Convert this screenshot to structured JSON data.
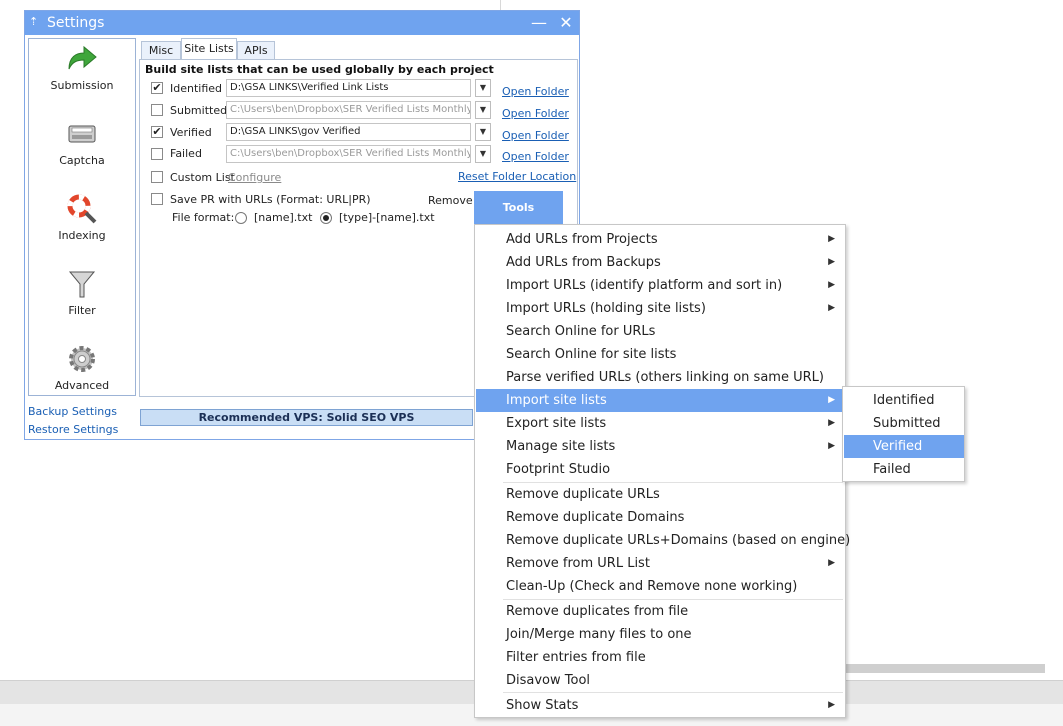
{
  "window": {
    "title": "Settings",
    "minimize_glyph": "—",
    "close_glyph": "✕"
  },
  "nav": {
    "items": [
      {
        "label": "Submission",
        "icon": "arrow-right-icon"
      },
      {
        "label": "Captcha",
        "icon": "captcha-keyboard-icon"
      },
      {
        "label": "Indexing",
        "icon": "lifebuoy-magnifier-icon"
      },
      {
        "label": "Filter",
        "icon": "funnel-icon"
      },
      {
        "label": "Advanced",
        "icon": "gear-icon"
      }
    ],
    "backup_label": "Backup Settings",
    "restore_label": "Restore Settings"
  },
  "tabs": [
    {
      "label": "Misc"
    },
    {
      "label": "Site Lists",
      "active": true
    },
    {
      "label": "APIs"
    }
  ],
  "site_lists": {
    "heading": "Build site lists that can be used globally by each project",
    "rows": [
      {
        "label": "Identified",
        "checked": true,
        "path": "D:\\GSA LINKS\\Verified Link Lists",
        "enabled": true,
        "link": "Open Folder"
      },
      {
        "label": "Submitted",
        "checked": false,
        "path": "C:\\Users\\ben\\Dropbox\\SER Verified Lists Monthly F",
        "enabled": false,
        "link": "Open Folder"
      },
      {
        "label": "Verified",
        "checked": true,
        "path": "D:\\GSA LINKS\\gov Verified",
        "enabled": true,
        "link": "Open Folder"
      },
      {
        "label": "Failed",
        "checked": false,
        "path": "C:\\Users\\ben\\Dropbox\\SER Verified Lists Monthly F",
        "enabled": false,
        "link": "Open Folder"
      }
    ],
    "custom_list_label": "Custom List",
    "configure_label": "Configure",
    "reset_folder_label": "Reset Folder Location",
    "save_pr_label": "Save PR with URLs (Format: URL|PR)",
    "remove_label": "Remove",
    "file_format_label": "File format:",
    "format_options": [
      "[name].txt",
      "[type]-[name].txt"
    ],
    "selected_format": "[type]-[name].txt",
    "tools_label": "Tools"
  },
  "vps_banner": "Recommended VPS: Solid SEO VPS",
  "checkmark_glyph": "✔",
  "dropdown_glyph": "▼",
  "submenu_arrow_glyph": "▶",
  "tools_menu": {
    "items": [
      {
        "label": "Add URLs from Projects",
        "submenu": true
      },
      {
        "label": "Add URLs from Backups",
        "submenu": true
      },
      {
        "label": "Import URLs (identify platform and sort in)",
        "submenu": true
      },
      {
        "label": "Import URLs (holding site lists)",
        "submenu": true
      },
      {
        "label": "Search Online for URLs",
        "submenu": false
      },
      {
        "label": "Search Online for site lists",
        "submenu": false
      },
      {
        "label": "Parse verified URLs (others linking on same URL)",
        "submenu": false
      },
      {
        "label": "Import site lists",
        "submenu": true,
        "highlighted": true
      },
      {
        "label": "Export site lists",
        "submenu": true
      },
      {
        "label": "Manage site lists",
        "submenu": true
      },
      {
        "label": "Footprint Studio",
        "submenu": false
      },
      {
        "label": "Remove duplicate URLs",
        "submenu": false
      },
      {
        "label": "Remove duplicate Domains",
        "submenu": false
      },
      {
        "label": "Remove duplicate URLs+Domains (based on engine)",
        "submenu": false
      },
      {
        "label": "Remove from URL List",
        "submenu": true
      },
      {
        "label": "Clean-Up (Check and Remove none working)",
        "submenu": false
      },
      {
        "label": "Remove duplicates from file",
        "submenu": false
      },
      {
        "label": "Join/Merge many files to one",
        "submenu": false
      },
      {
        "label": "Filter entries from file",
        "submenu": false
      },
      {
        "label": "Disavow Tool",
        "submenu": false
      },
      {
        "label": "Show Stats",
        "submenu": true
      }
    ]
  },
  "import_submenu": {
    "items": [
      {
        "label": "Identified"
      },
      {
        "label": "Submitted"
      },
      {
        "label": "Verified",
        "highlighted": true
      },
      {
        "label": "Failed"
      }
    ]
  },
  "colors": {
    "accent": "#6fa3ef",
    "link": "#1a5fb4",
    "banner_bg": "#c9def5"
  }
}
